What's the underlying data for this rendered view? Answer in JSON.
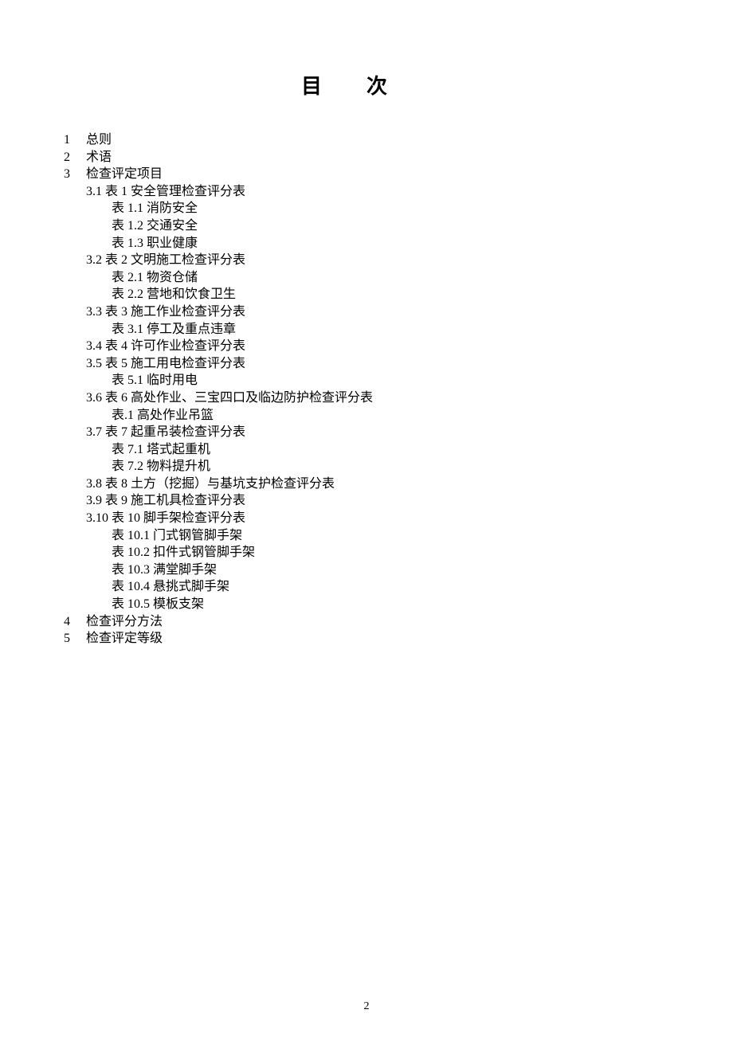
{
  "title": "目次",
  "page_number": "2",
  "toc": {
    "sections": [
      {
        "num": "1",
        "label": "总则",
        "children": []
      },
      {
        "num": "2",
        "label": "术语",
        "children": []
      },
      {
        "num": "3",
        "label": "检查评定项目",
        "children": [
          {
            "label": "3.1 表 1 安全管理检查评分表",
            "children": [
              {
                "label": "表 1.1 消防安全"
              },
              {
                "label": "表 1.2 交通安全"
              },
              {
                "label": "表 1.3 职业健康"
              }
            ]
          },
          {
            "label": "3.2 表 2  文明施工检查评分表",
            "children": [
              {
                "label": "表 2.1 物资仓储"
              },
              {
                "label": "表 2.2 营地和饮食卫生"
              }
            ]
          },
          {
            "label": "3.3  表 3  施工作业检查评分表",
            "children": [
              {
                "label": "表 3.1 停工及重点违章"
              }
            ]
          },
          {
            "label": "3.4  表 4 许可作业检查评分表",
            "children": []
          },
          {
            "label": "3.5 表 5 施工用电检查评分表",
            "children": [
              {
                "label": "表 5.1 临时用电"
              }
            ]
          },
          {
            "label": "3.6 表 6 高处作业、三宝四口及临边防护检查评分表",
            "children": [
              {
                "label": "表.1 高处作业吊篮"
              }
            ]
          },
          {
            "label": "3.7 表 7 起重吊装检查评分表",
            "children": [
              {
                "label": "表 7.1 塔式起重机"
              },
              {
                "label": "表 7.2 物料提升机"
              }
            ]
          },
          {
            "label": "3.8  表 8 土方（挖掘）与基坑支护检查评分表",
            "children": []
          },
          {
            "label": "3.9  表 9 施工机具检查评分表",
            "children": []
          },
          {
            "label": "3.10 表 10 脚手架检查评分表",
            "children": [
              {
                "label": "表 10.1 门式钢管脚手架"
              },
              {
                "label": "表 10.2 扣件式钢管脚手架"
              },
              {
                "label": "表 10.3 满堂脚手架"
              },
              {
                "label": "表 10.4 悬挑式脚手架"
              },
              {
                "label": "表 10.5 模板支架"
              }
            ]
          }
        ]
      },
      {
        "num": "4",
        "label": "检查评分方法",
        "children": []
      },
      {
        "num": "5",
        "label": "检查评定等级",
        "children": []
      }
    ]
  }
}
